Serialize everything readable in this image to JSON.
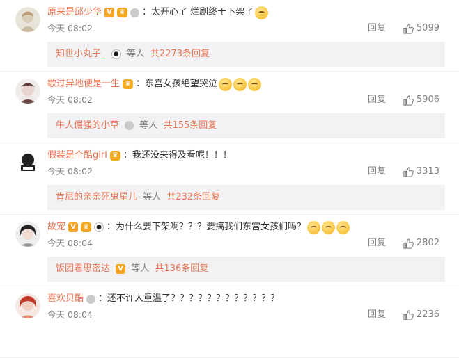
{
  "comments": [
    {
      "username": "原来是邱少华",
      "text": "：太开心了 烂剧终于下架了",
      "time": "今天 08:02",
      "reply_label": "回复",
      "likes": "5099",
      "sub": {
        "name": "知世小丸子_",
        "mid": "等人",
        "count": "共2273条回复"
      }
    },
    {
      "username": "歇过异地便是一生",
      "text": "：东宫女孩绝望哭泣",
      "time": "今天 08:02",
      "reply_label": "回复",
      "likes": "5906",
      "sub": {
        "name": "牛人倔强的小草",
        "mid": "等人",
        "count": "共155条回复"
      }
    },
    {
      "username": "假装是个酷girl",
      "text": "：我还没来得及看呢！！！",
      "time": "今天 08:02",
      "reply_label": "回复",
      "likes": "3313",
      "sub": {
        "name": "肯尼的亲亲死鬼星儿",
        "mid": "等人",
        "count": "共232条回复"
      }
    },
    {
      "username": "故宠",
      "text": "：为什么要下架啊？？？要搞我们东宫女孩们吗？",
      "time": "今天 08:04",
      "reply_label": "回复",
      "likes": "2802",
      "sub": {
        "name": "饭团君思密达",
        "mid": "等人",
        "count": "共136条回复"
      }
    },
    {
      "username": "喜欢贝酷",
      "text": "：还不许人重温了？？？？？？？？？？？？",
      "time": "今天 08:04",
      "reply_label": "回复",
      "likes": "2236"
    }
  ],
  "icons": {
    "like": "thumbs-up-icon",
    "vip": "vip-badge-icon",
    "member": "member-crown-icon",
    "medal": "medal-icon",
    "panda": "panda-icon",
    "emoji": "emoji-icon"
  },
  "colors": {
    "username": "#eb7350",
    "meta": "#808080",
    "reply_bg": "#f2f2f5"
  }
}
